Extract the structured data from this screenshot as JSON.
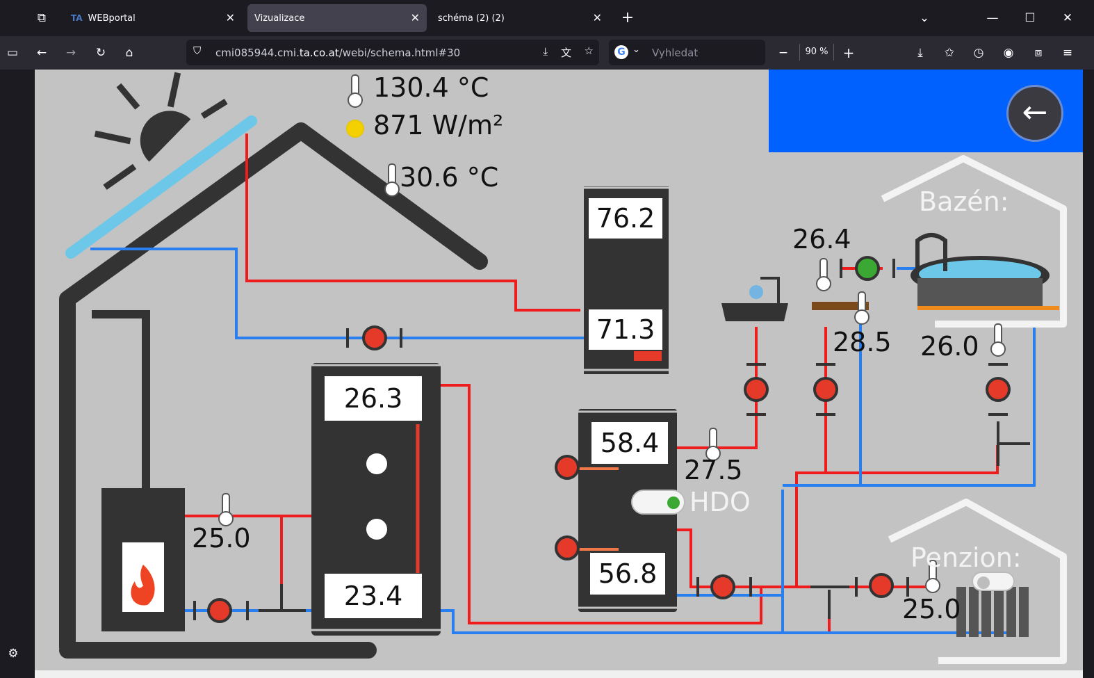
{
  "tabs": [
    {
      "label": "WEBportal",
      "icon": "ta-logo-icon"
    },
    {
      "label": "Vizualizace",
      "active": true
    },
    {
      "label": "schéma (2) (2)"
    }
  ],
  "address": {
    "prefix": "cmi085944.cmi.",
    "domain": "ta.co.at",
    "path": "/webi/schema.html#30"
  },
  "search_placeholder": "Vyhledat",
  "zoom": "90 %",
  "readings": {
    "collector_temp": "130.4 °C",
    "irradiance": "871 W/m²",
    "outdoor_temp": "30.6 °C",
    "tank1_top": "76.2",
    "tank1_bottom": "71.3",
    "buffer_top": "26.3",
    "buffer_bottom": "23.4",
    "boiler_temp": "25.0",
    "tank2_top": "58.4",
    "tank2_bottom": "56.8",
    "tank2_out": "27.5",
    "pool_in": "26.4",
    "pool_hx": "28.5",
    "pool_return": "26.0",
    "pension_temp": "25.0"
  },
  "labels": {
    "hdo": "HDO",
    "pool": "Bazén:",
    "pension": "Penzion:"
  },
  "colors": {
    "hot": "#ee1c1c",
    "cold": "#2a7ff0",
    "pump": "#e53a2a",
    "pump_active": "#3aa832",
    "bg": "#c3c3c3",
    "header": "#0061fe"
  }
}
